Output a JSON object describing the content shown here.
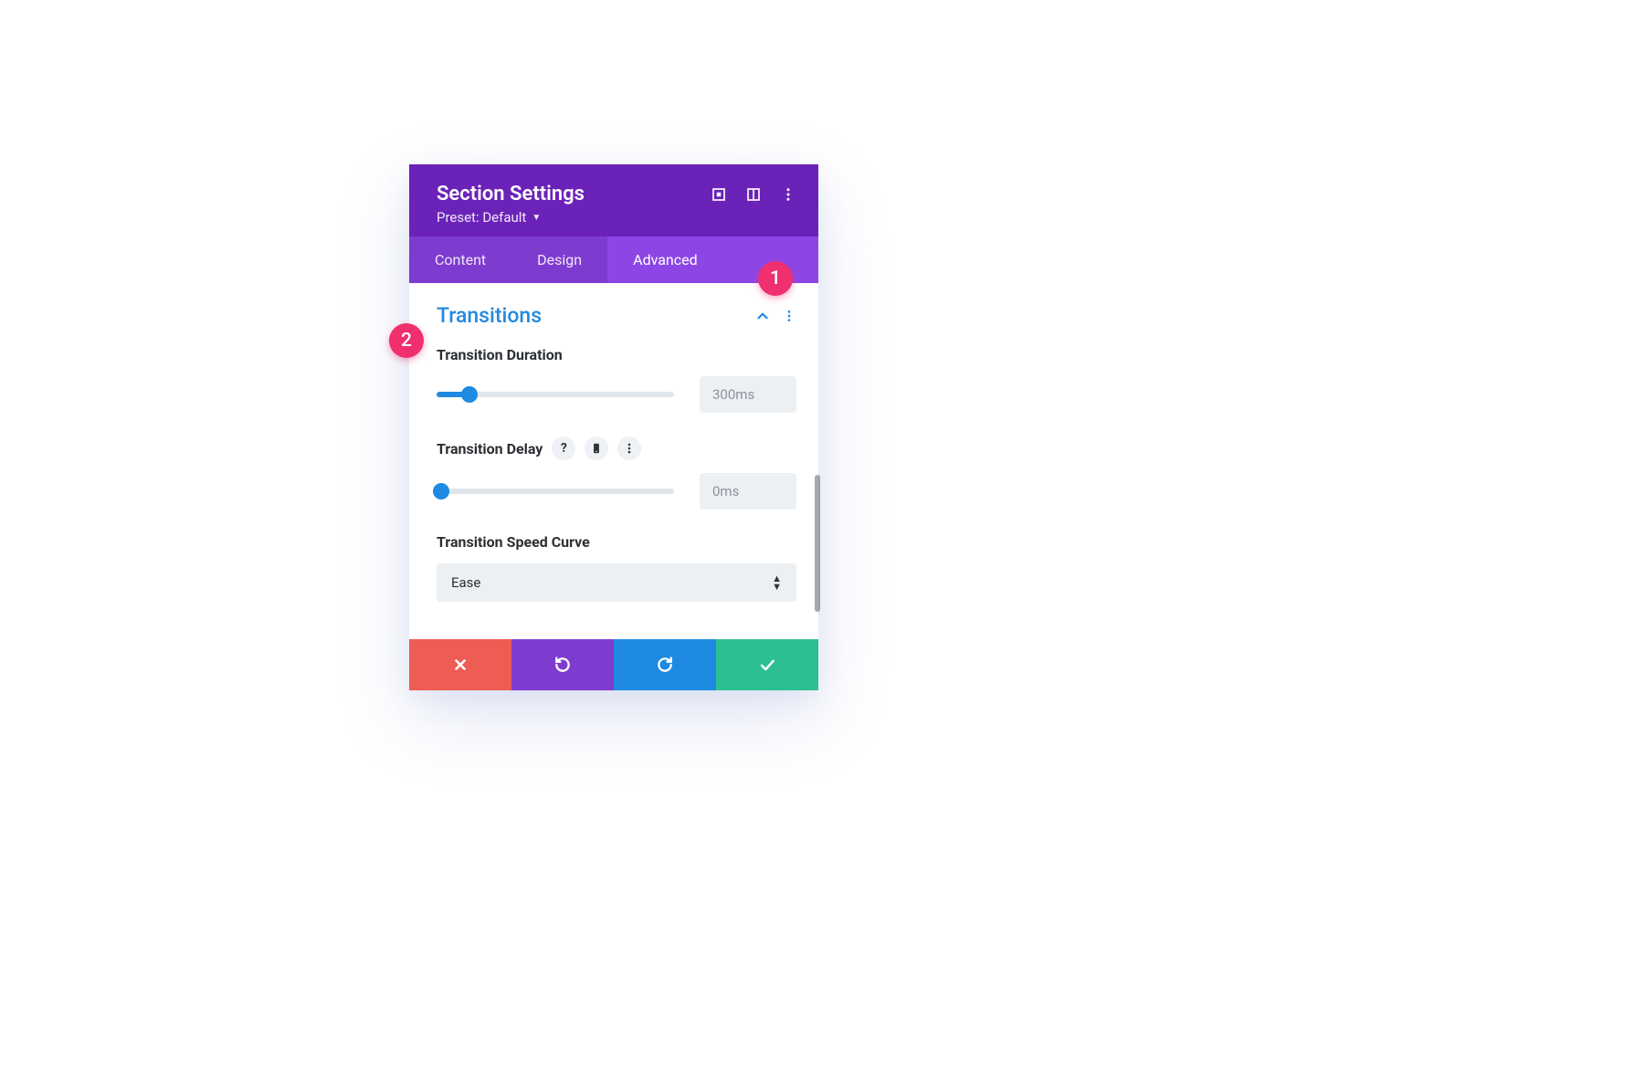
{
  "header": {
    "title": "Section Settings",
    "preset_label": "Preset: Default"
  },
  "tabs": {
    "content": "Content",
    "design": "Design",
    "advanced": "Advanced",
    "active": "advanced"
  },
  "section": {
    "title": "Transitions"
  },
  "fields": {
    "duration": {
      "label": "Transition Duration",
      "value": "300ms",
      "slider_percent": 14
    },
    "delay": {
      "label": "Transition Delay",
      "value": "0ms",
      "slider_percent": 0
    },
    "speed_curve": {
      "label": "Transition Speed Curve",
      "value": "Ease"
    }
  },
  "annotations": {
    "a1": "1",
    "a2": "2"
  }
}
